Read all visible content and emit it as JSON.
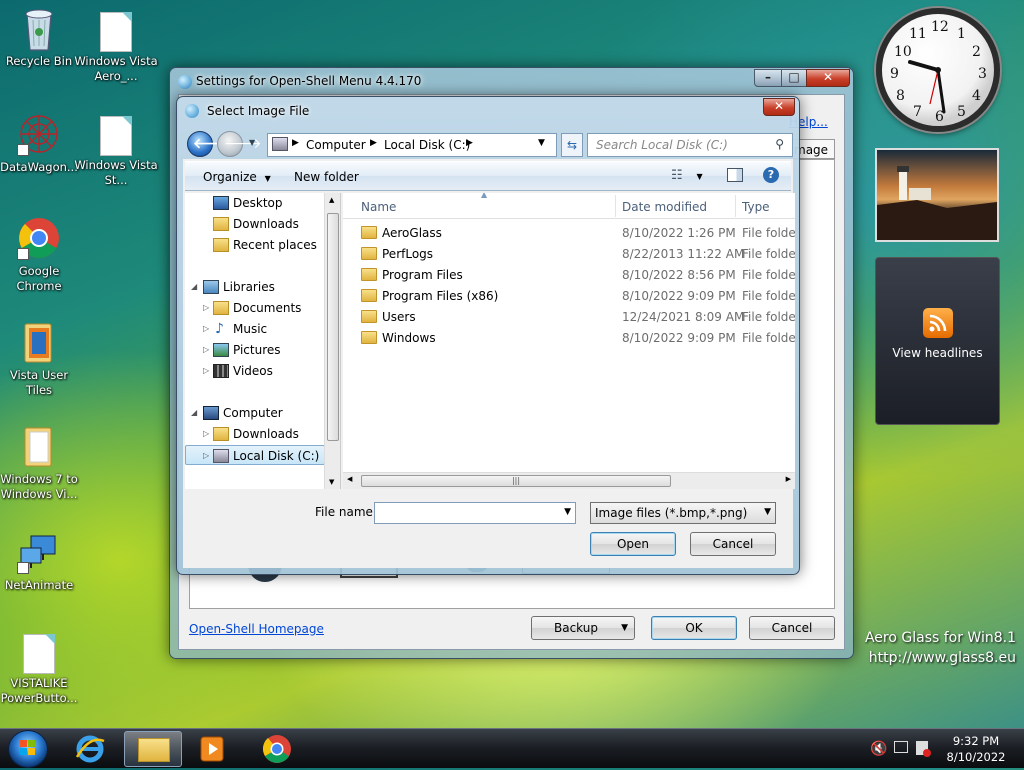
{
  "desktop": {
    "icons": [
      {
        "label": "Recycle Bin"
      },
      {
        "label": "Windows Vista Aero_..."
      },
      {
        "label": "DataWagon..."
      },
      {
        "label": "Windows Vista St..."
      },
      {
        "label": "Google Chrome"
      },
      {
        "label": "Vista User Tiles"
      },
      {
        "label": "Windows 7 to Windows Vi..."
      },
      {
        "label": "NetAnimate"
      },
      {
        "label": "VISTALIKE PowerButto..."
      }
    ],
    "branding_line1": "Aero Glass for Win8.1",
    "branding_line2": "http://www.glass8.eu"
  },
  "gadgets": {
    "clock_numbers": [
      "12",
      "1",
      "2",
      "3",
      "4",
      "5",
      "6",
      "7",
      "8",
      "9",
      "10",
      "11"
    ],
    "rss_label": "View headlines"
  },
  "settings_window": {
    "title": "Settings for Open-Shell Menu 4.4.170",
    "help_link": "Help...",
    "tab_partial": "mage",
    "homepage_link": "Open-Shell Homepage",
    "backup_label": "Backup",
    "ok_label": "OK",
    "cancel_label": "Cancel"
  },
  "file_dialog": {
    "title": "Select Image File",
    "breadcrumb": [
      "Computer",
      "Local Disk (C:)"
    ],
    "search_placeholder": "Search Local Disk (C:)",
    "organize_label": "Organize",
    "new_folder_label": "New folder",
    "nav": {
      "favorites": [
        "Desktop",
        "Downloads",
        "Recent places"
      ],
      "libraries_label": "Libraries",
      "libraries": [
        "Documents",
        "Music",
        "Pictures",
        "Videos"
      ],
      "computer_label": "Computer",
      "computer": [
        "Downloads",
        "Local Disk (C:)"
      ]
    },
    "columns": {
      "name": "Name",
      "date": "Date modified",
      "type": "Type"
    },
    "files": [
      {
        "name": "AeroGlass",
        "date": "8/10/2022 1:26 PM",
        "type": "File folder"
      },
      {
        "name": "PerfLogs",
        "date": "8/22/2013 11:22 AM",
        "type": "File folder"
      },
      {
        "name": "Program Files",
        "date": "8/10/2022 8:56 PM",
        "type": "File folder"
      },
      {
        "name": "Program Files (x86)",
        "date": "8/10/2022 9:09 PM",
        "type": "File folder"
      },
      {
        "name": "Users",
        "date": "12/24/2021 8:09 AM",
        "type": "File folder"
      },
      {
        "name": "Windows",
        "date": "8/10/2022 9:09 PM",
        "type": "File folder"
      }
    ],
    "filename_label": "File name:",
    "filename_value": "",
    "filetype_value": "Image files (*.bmp,*.png)",
    "open_label": "Open",
    "cancel_label": "Cancel"
  },
  "taskbar": {
    "time": "9:32 PM",
    "date": "8/10/2022"
  }
}
